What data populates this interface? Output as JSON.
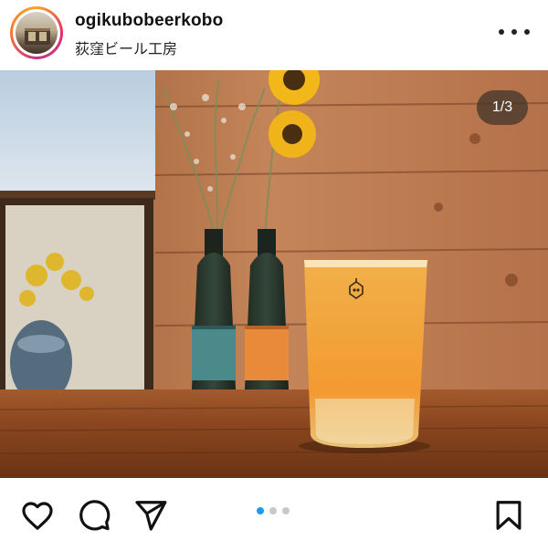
{
  "post": {
    "username": "ogikubobeerkobo",
    "subtitle": "荻窪ビール工房",
    "carousel": {
      "counter": "1/3",
      "current": 1,
      "total": 3
    }
  },
  "icons": {
    "more": "more-horizontal-icon",
    "like": "heart-icon",
    "comment": "comment-icon",
    "share": "send-icon",
    "save": "bookmark-icon"
  },
  "colors": {
    "accent": "#1d9bf0",
    "beer": "#f1a13a",
    "table": "#8a4a22",
    "wall": "#b8754a"
  }
}
